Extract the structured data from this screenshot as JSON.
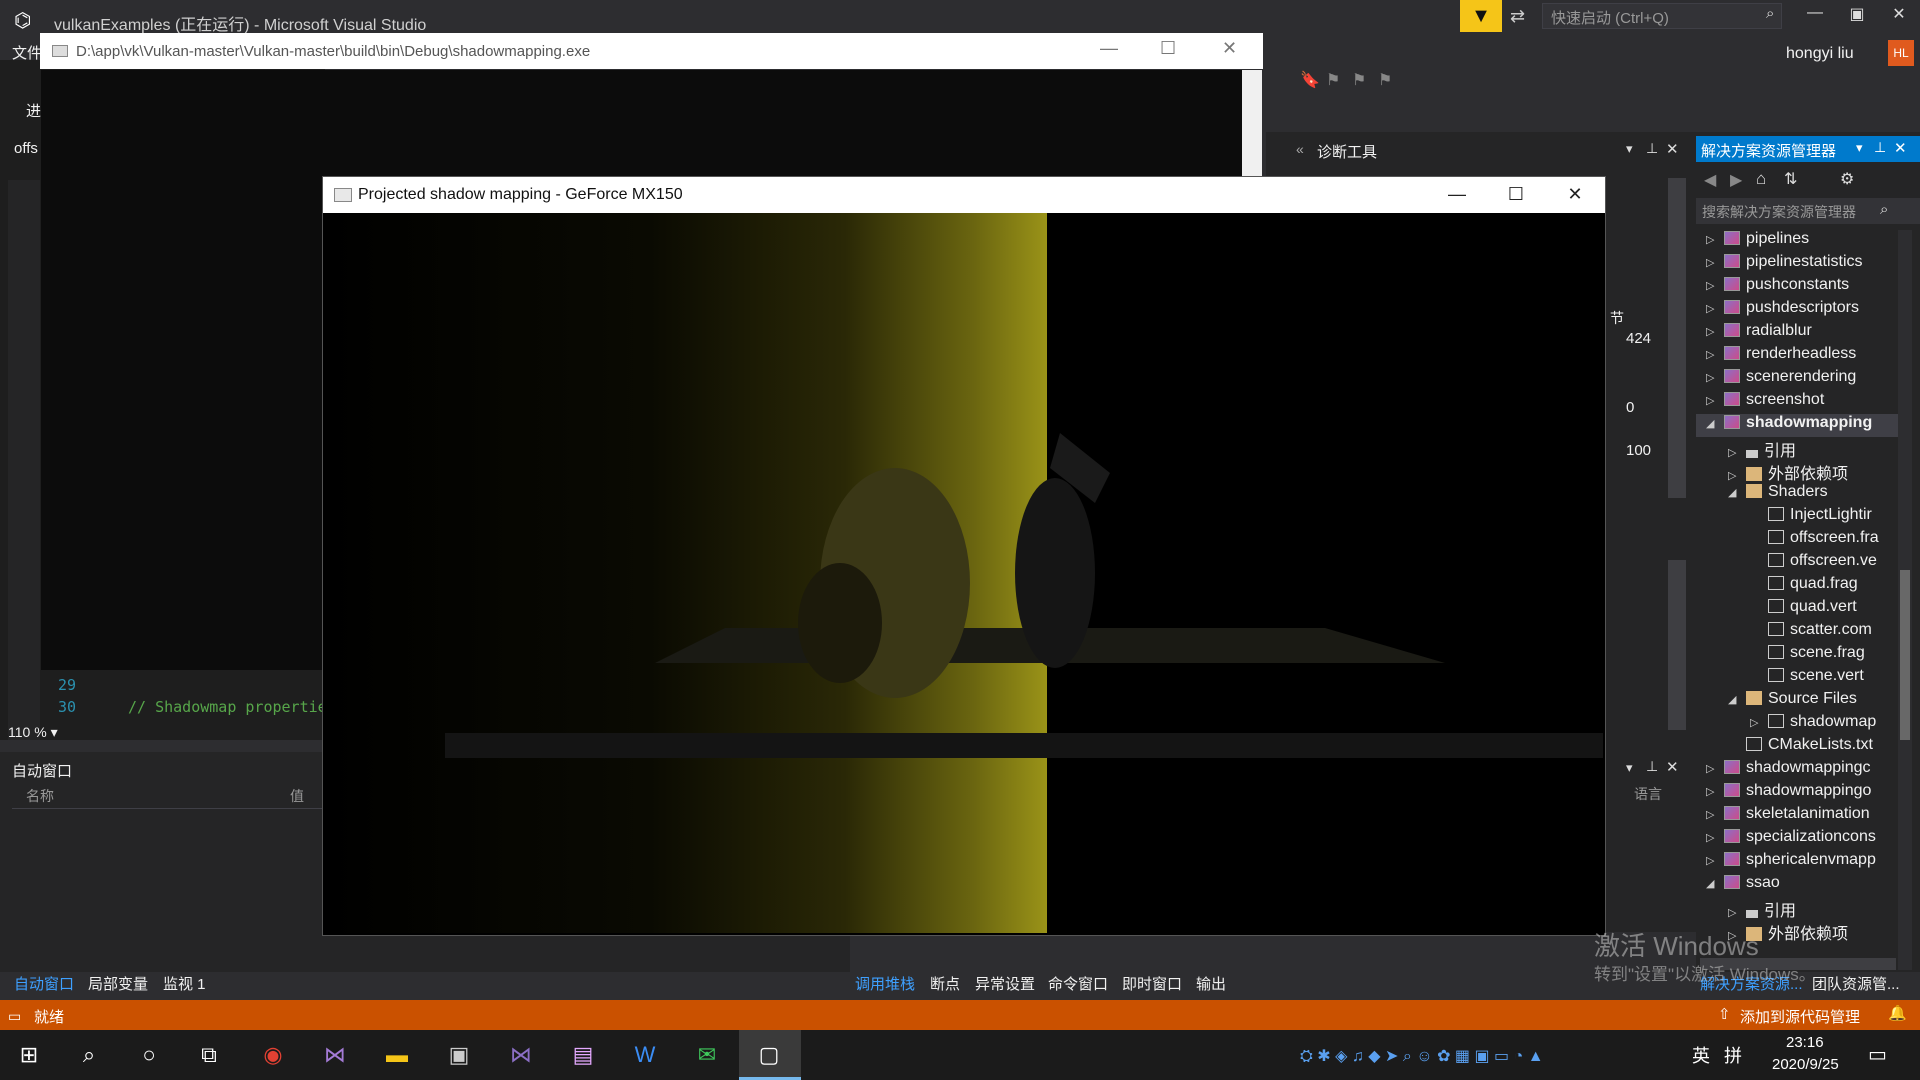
{
  "vs": {
    "title": "vulkanExamples (正在运行) - Microsoft Visual Studio",
    "quick_launch_placeholder": "快速启动 (Ctrl+Q)",
    "user": "hongyi liu",
    "avatar": "HL",
    "menu_file": "文件",
    "left_fragment_1": "进",
    "left_fragment_2": "offs",
    "line_numbers": [
      "29",
      "30"
    ],
    "code_line_30": "// Shadowmap properties",
    "zoom": "110 %",
    "autos_title": "自动窗口",
    "autos_col_name": "名称",
    "autos_col_value": "值",
    "bottom_tabs_left": [
      "自动窗口",
      "局部变量",
      "监视 1"
    ],
    "bottom_tabs_right": [
      "调用堆栈",
      "断点",
      "异常设置",
      "命令窗口",
      "即时窗口",
      "输出"
    ],
    "diag_title": "诊断工具",
    "diag_values": [
      "424",
      "0",
      "100"
    ],
    "diag_char": "节",
    "diag_lang": "语言",
    "status_ready": "就绪",
    "status_scm": "添加到源代码管理",
    "solution_tab_bottom": "解决方案资源...",
    "team_tab_bottom": "团队资源管..."
  },
  "console": {
    "path": "D:\\app\\vk\\Vulkan-master\\Vulkan-master\\build\\bin\\Debug\\shadowmapping.exe"
  },
  "render_window": {
    "title": "Projected shadow mapping - GeForce MX150"
  },
  "solution_explorer": {
    "title": "解决方案资源管理器",
    "search_placeholder": "搜索解决方案资源管理器",
    "rows": [
      {
        "label": "pipelines",
        "indent": 0,
        "arrow": "▷",
        "icon": "proj"
      },
      {
        "label": "pipelinestatistics",
        "indent": 0,
        "arrow": "▷",
        "icon": "proj"
      },
      {
        "label": "pushconstants",
        "indent": 0,
        "arrow": "▷",
        "icon": "proj"
      },
      {
        "label": "pushdescriptors",
        "indent": 0,
        "arrow": "▷",
        "icon": "proj"
      },
      {
        "label": "radialblur",
        "indent": 0,
        "arrow": "▷",
        "icon": "proj"
      },
      {
        "label": "renderheadless",
        "indent": 0,
        "arrow": "▷",
        "icon": "proj"
      },
      {
        "label": "scenerendering",
        "indent": 0,
        "arrow": "▷",
        "icon": "proj"
      },
      {
        "label": "screenshot",
        "indent": 0,
        "arrow": "▷",
        "icon": "proj"
      },
      {
        "label": "shadowmapping",
        "indent": 0,
        "arrow": "◢",
        "icon": "proj",
        "selected": true
      },
      {
        "label": "引用",
        "indent": 1,
        "arrow": "▷",
        "icon": "ref"
      },
      {
        "label": "外部依赖项",
        "indent": 1,
        "arrow": "▷",
        "icon": "folder"
      },
      {
        "label": "Shaders",
        "indent": 1,
        "arrow": "◢",
        "icon": "folder"
      },
      {
        "label": "InjectLightir",
        "indent": 2,
        "arrow": "",
        "icon": "file"
      },
      {
        "label": "offscreen.fra",
        "indent": 2,
        "arrow": "",
        "icon": "file"
      },
      {
        "label": "offscreen.ve",
        "indent": 2,
        "arrow": "",
        "icon": "file"
      },
      {
        "label": "quad.frag",
        "indent": 2,
        "arrow": "",
        "icon": "file"
      },
      {
        "label": "quad.vert",
        "indent": 2,
        "arrow": "",
        "icon": "file"
      },
      {
        "label": "scatter.com",
        "indent": 2,
        "arrow": "",
        "icon": "file"
      },
      {
        "label": "scene.frag",
        "indent": 2,
        "arrow": "",
        "icon": "file"
      },
      {
        "label": "scene.vert",
        "indent": 2,
        "arrow": "",
        "icon": "file"
      },
      {
        "label": "Source Files",
        "indent": 1,
        "arrow": "◢",
        "icon": "folder"
      },
      {
        "label": "shadowmap",
        "indent": 2,
        "arrow": "▷",
        "icon": "file"
      },
      {
        "label": "CMakeLists.txt",
        "indent": 1,
        "arrow": "",
        "icon": "file"
      },
      {
        "label": "shadowmappingc",
        "indent": 0,
        "arrow": "▷",
        "icon": "proj"
      },
      {
        "label": "shadowmappingo",
        "indent": 0,
        "arrow": "▷",
        "icon": "proj"
      },
      {
        "label": "skeletalanimation",
        "indent": 0,
        "arrow": "▷",
        "icon": "proj"
      },
      {
        "label": "specializationcons",
        "indent": 0,
        "arrow": "▷",
        "icon": "proj"
      },
      {
        "label": "sphericalenvmapp",
        "indent": 0,
        "arrow": "▷",
        "icon": "proj"
      },
      {
        "label": "ssao",
        "indent": 0,
        "arrow": "◢",
        "icon": "proj"
      },
      {
        "label": "引用",
        "indent": 1,
        "arrow": "▷",
        "icon": "ref"
      },
      {
        "label": "外部依赖项",
        "indent": 1,
        "arrow": "▷",
        "icon": "folder"
      }
    ]
  },
  "watermark": {
    "line1": "激活 Windows",
    "line2": "转到\"设置\"以激活 Windows。"
  },
  "taskbar": {
    "time": "23:16",
    "date": "2020/9/25",
    "ime": "英",
    "ime2": "拼"
  }
}
